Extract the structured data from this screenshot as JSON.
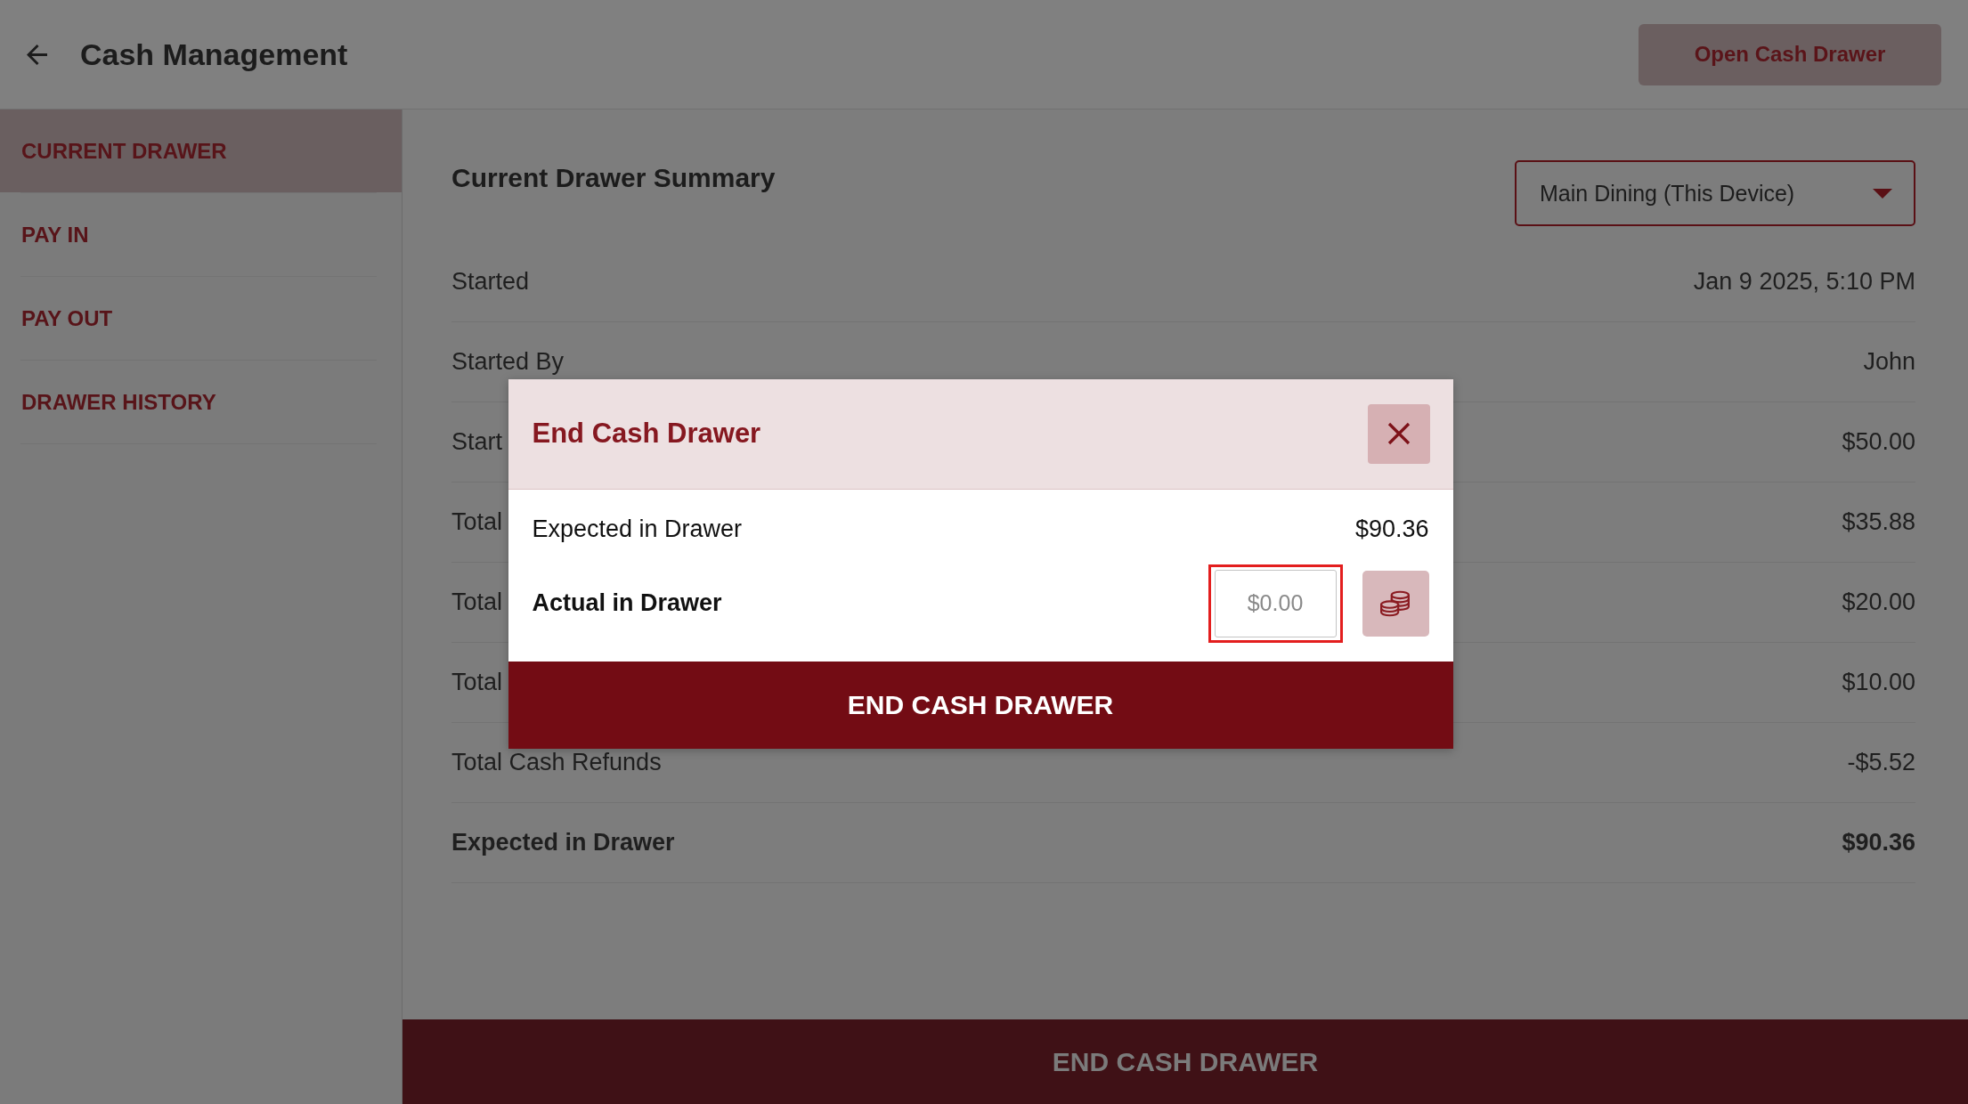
{
  "header": {
    "title": "Cash Management",
    "action_button": "Open Cash Drawer"
  },
  "sidebar": {
    "items": [
      {
        "label": "CURRENT DRAWER",
        "selected": true
      },
      {
        "label": "PAY IN",
        "selected": false
      },
      {
        "label": "PAY OUT",
        "selected": false
      },
      {
        "label": "DRAWER HISTORY",
        "selected": false
      }
    ]
  },
  "summary": {
    "title": "Current Drawer Summary",
    "location_select": {
      "value": "Main Dining (This Device)"
    },
    "rows": [
      {
        "label": "Started",
        "value": "Jan 9 2025, 5:10 PM",
        "bold": false
      },
      {
        "label": "Started By",
        "value": "John",
        "bold": false
      },
      {
        "label": "Start",
        "value": "$50.00",
        "bold": false
      },
      {
        "label": "Total",
        "value": "$35.88",
        "bold": false
      },
      {
        "label": "Total",
        "value": "$20.00",
        "bold": false
      },
      {
        "label": "Total",
        "value": "$10.00",
        "bold": false
      },
      {
        "label": "Total Cash Refunds",
        "value": "-$5.52",
        "bold": false
      },
      {
        "label": "Expected in Drawer",
        "value": "$90.36",
        "bold": true
      }
    ]
  },
  "footer_button": "END CASH DRAWER",
  "modal": {
    "title": "End Cash Drawer",
    "rows": [
      {
        "kind": "amount",
        "label": "Expected in Drawer",
        "value": "$90.36"
      },
      {
        "kind": "input",
        "label": "Actual in Drawer",
        "placeholder": "$0.00",
        "highlighted": true
      }
    ],
    "submit_button": "END CASH DRAWER"
  }
}
